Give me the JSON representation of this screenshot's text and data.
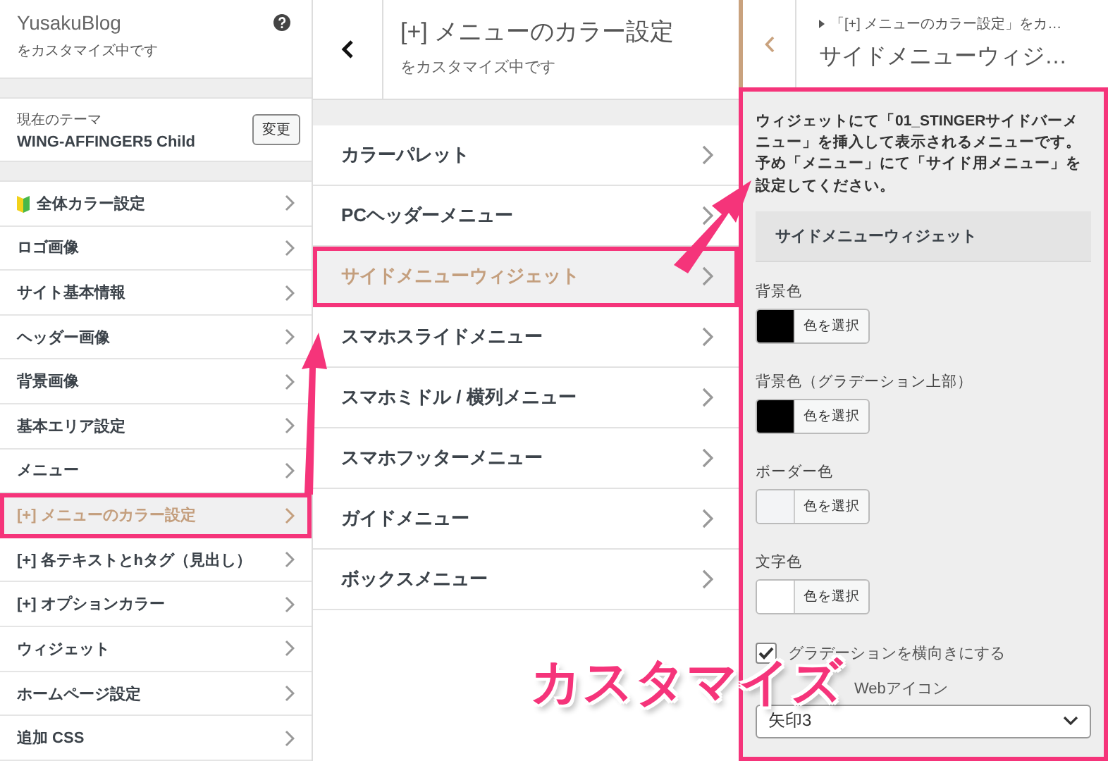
{
  "customizer": {
    "title": "YusakuBlog",
    "subtitle": "をカスタマイズ中です"
  },
  "theme": {
    "label": "現在のテーマ",
    "name": "WING-AFFINGER5 Child",
    "button": "変更"
  },
  "sections": [
    {
      "label": "全体カラー設定",
      "kind": "icon",
      "selected": false,
      "highlighted": false
    },
    {
      "label": "ロゴ画像",
      "kind": "plain",
      "selected": false,
      "highlighted": false
    },
    {
      "label": "サイト基本情報",
      "kind": "plain",
      "selected": false,
      "highlighted": false
    },
    {
      "label": "ヘッダー画像",
      "kind": "plain",
      "selected": false,
      "highlighted": false
    },
    {
      "label": "背景画像",
      "kind": "plain",
      "selected": false,
      "highlighted": false
    },
    {
      "label": "基本エリア設定",
      "kind": "plain",
      "selected": false,
      "highlighted": false
    },
    {
      "label": "メニュー",
      "kind": "plain",
      "selected": false,
      "highlighted": false
    },
    {
      "label": "[+] メニューのカラー設定",
      "kind": "plain",
      "selected": true,
      "highlighted": true
    },
    {
      "label": "[+] 各テキストとhタグ（見出し）",
      "kind": "plain",
      "selected": false,
      "highlighted": false
    },
    {
      "label": "[+] オプションカラー",
      "kind": "plain",
      "selected": false,
      "highlighted": false
    },
    {
      "label": "ウィジェット",
      "kind": "plain",
      "selected": false,
      "highlighted": false
    },
    {
      "label": "ホームページ設定",
      "kind": "plain",
      "selected": false,
      "highlighted": false
    },
    {
      "label": "追加 CSS",
      "kind": "plain",
      "selected": false,
      "highlighted": false
    }
  ],
  "submenu": {
    "title": "[+] メニューのカラー設定",
    "subtitle": "をカスタマイズ中です",
    "items": [
      {
        "label": "カラーパレット",
        "selected": false,
        "highlighted": false
      },
      {
        "label": "PCヘッダーメニュー",
        "selected": false,
        "highlighted": false
      },
      {
        "label": "サイドメニューウィジェット",
        "selected": true,
        "highlighted": true
      },
      {
        "label": "スマホスライドメニュー",
        "selected": false,
        "highlighted": false
      },
      {
        "label": "スマホミドル / 横列メニュー",
        "selected": false,
        "highlighted": false
      },
      {
        "label": "スマホフッターメニュー",
        "selected": false,
        "highlighted": false
      },
      {
        "label": "ガイドメニュー",
        "selected": false,
        "highlighted": false
      },
      {
        "label": "ボックスメニュー",
        "selected": false,
        "highlighted": false
      }
    ]
  },
  "widget_panel": {
    "breadcrumb": "「[+] メニューのカラー設定」をカ…",
    "title": "サイドメニューウィジ…",
    "highlighted": true,
    "description": "ウィジェットにて「01_STINGERサイドバーメニュー」を挿入して表示されるメニューです。予め「メニュー」にて「サイド用メニュー」を設定してください。",
    "heading": "サイドメニューウィジェット",
    "colors": [
      {
        "label": "背景色",
        "button": "色を選択",
        "color": "#000000"
      },
      {
        "label": "背景色（グラデーション上部）",
        "button": "色を選択",
        "color": "#000000"
      },
      {
        "label": "ボーダー色",
        "button": "色を選択",
        "color": "#f3f4f6"
      },
      {
        "label": "文字色",
        "button": "色を選択",
        "color": "#ffffff"
      }
    ],
    "checkbox": {
      "label": "グラデーションを横向きにする",
      "checked": true
    },
    "select": {
      "label": "Webアイコン",
      "value": "矢印3"
    }
  },
  "annotation": {
    "caption": "カスタマイズ"
  }
}
